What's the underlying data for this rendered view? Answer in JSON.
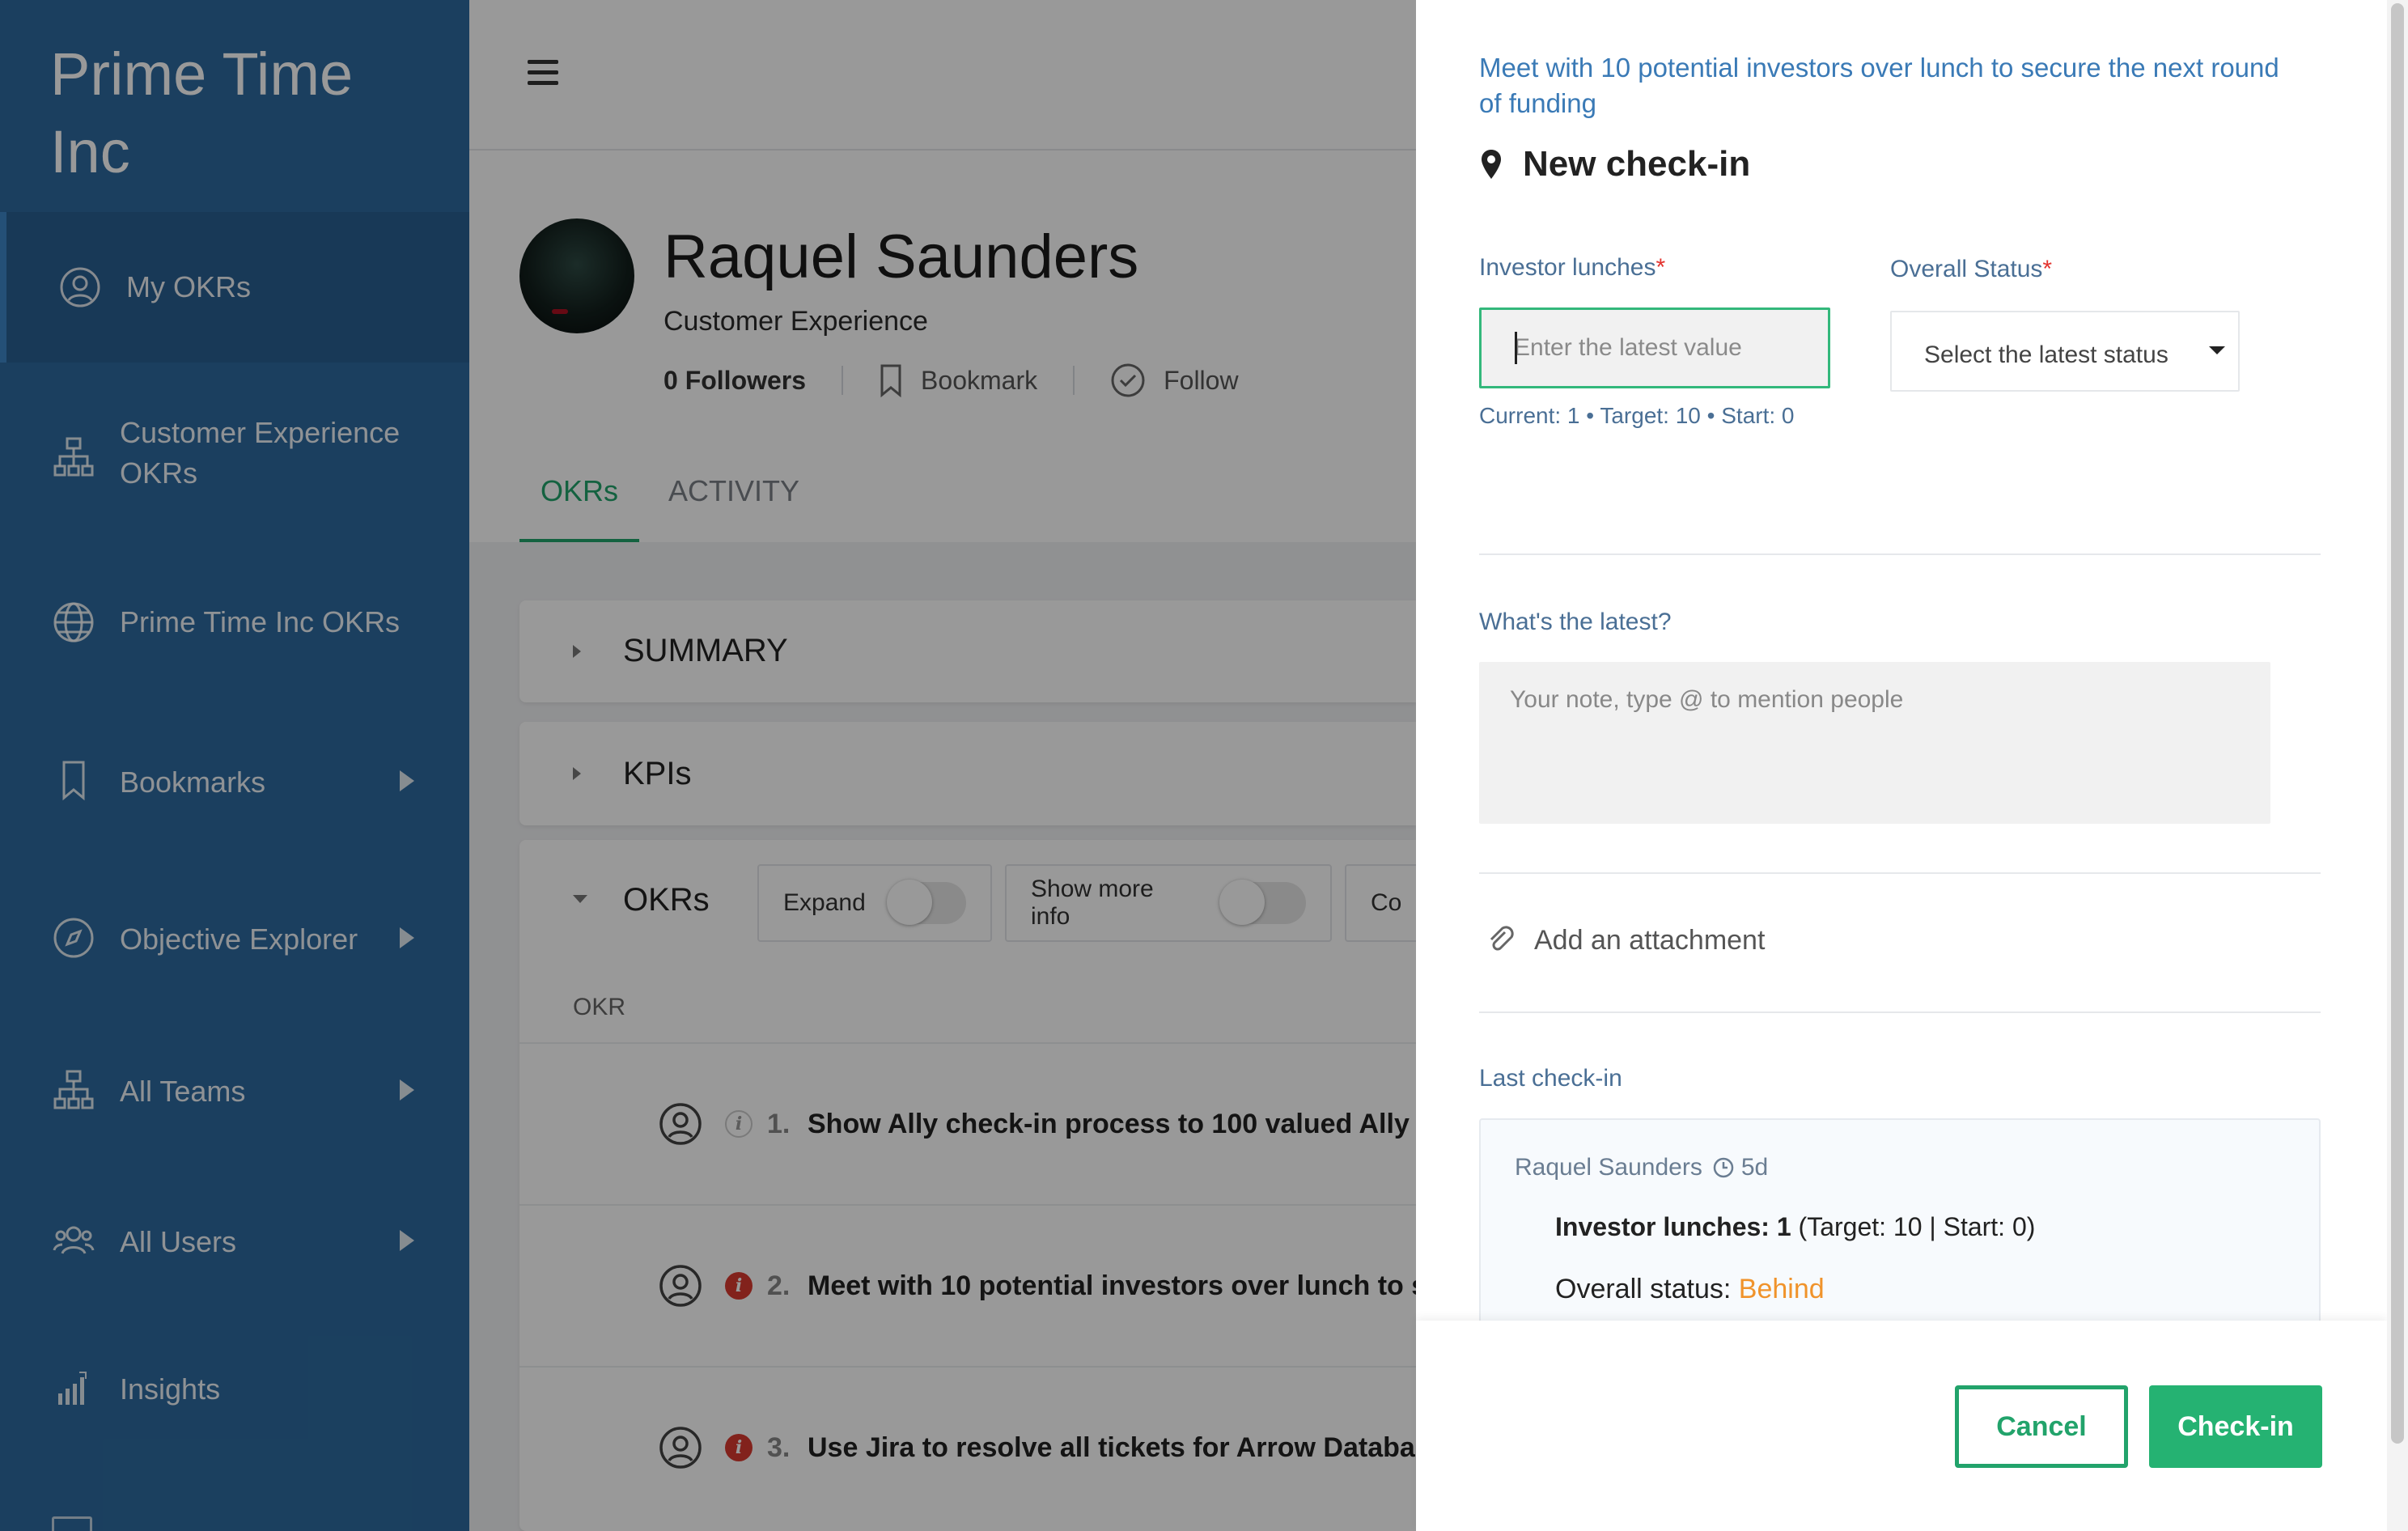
{
  "sidebar": {
    "brand": "Prime Time Inc",
    "items": [
      {
        "label": "My OKRs",
        "icon": "user-circle-icon",
        "active": true,
        "expandable": false
      },
      {
        "label": "Customer Experience OKRs",
        "icon": "org-chart-icon",
        "active": false,
        "expandable": false
      },
      {
        "label": "Prime Time Inc OKRs",
        "icon": "globe-icon",
        "active": false,
        "expandable": false
      },
      {
        "label": "Bookmarks",
        "icon": "bookmark-icon",
        "active": false,
        "expandable": true
      },
      {
        "label": "Objective Explorer",
        "icon": "compass-icon",
        "active": false,
        "expandable": true
      },
      {
        "label": "All Teams",
        "icon": "org-chart-icon",
        "active": false,
        "expandable": true
      },
      {
        "label": "All Users",
        "icon": "users-icon",
        "active": false,
        "expandable": true
      },
      {
        "label": "Insights",
        "icon": "bar-chart-icon",
        "active": false,
        "expandable": false
      }
    ]
  },
  "profile": {
    "name": "Raquel Saunders",
    "team": "Customer Experience",
    "followers": "0 Followers",
    "bookmark_label": "Bookmark",
    "follow_label": "Follow",
    "tabs": [
      "OKRs",
      "ACTIVITY"
    ]
  },
  "panels": {
    "summary": "SUMMARY",
    "kpis": "KPIs",
    "okrs": "OKRs",
    "expand_label": "Expand",
    "show_more_label": "Show more info",
    "truncated_filter": "Co",
    "column_header": "OKR",
    "rows": [
      {
        "num": "1.",
        "text": "Show Ally check-in process to 100 valued Ally",
        "info": "light"
      },
      {
        "num": "2.",
        "text": "Meet with 10 potential investors over lunch to s",
        "info": "red"
      },
      {
        "num": "3.",
        "text": "Use Jira to resolve all tickets for Arrow Databas",
        "info": "red"
      }
    ]
  },
  "drawer": {
    "objective": "Meet with 10 potential investors over lunch to secure the next round of funding",
    "heading": "New check-in",
    "kr_label": "Investor lunches",
    "value_placeholder": "Enter the latest value",
    "hint": "Current: 1 • Target: 10 • Start: 0",
    "status_label": "Overall Status",
    "status_placeholder": "Select the latest status",
    "note_label": "What's the latest?",
    "note_placeholder": "Your note, type @ to mention people",
    "attachment_label": "Add an attachment",
    "last_checkin_label": "Last check-in",
    "last_checkin": {
      "author": "Raquel Saunders",
      "age": "5d",
      "kr_name": "Investor lunches: 1",
      "kr_detail": "(Target: 10 | Start: 0)",
      "status_prefix": "Overall status:",
      "status_value": "Behind"
    },
    "cancel_label": "Cancel",
    "submit_label": "Check-in"
  },
  "colors": {
    "sidebar": "#2d6a9f",
    "accent_green": "#22a36b",
    "status_behind": "#f0932b",
    "required": "#e3342f"
  }
}
